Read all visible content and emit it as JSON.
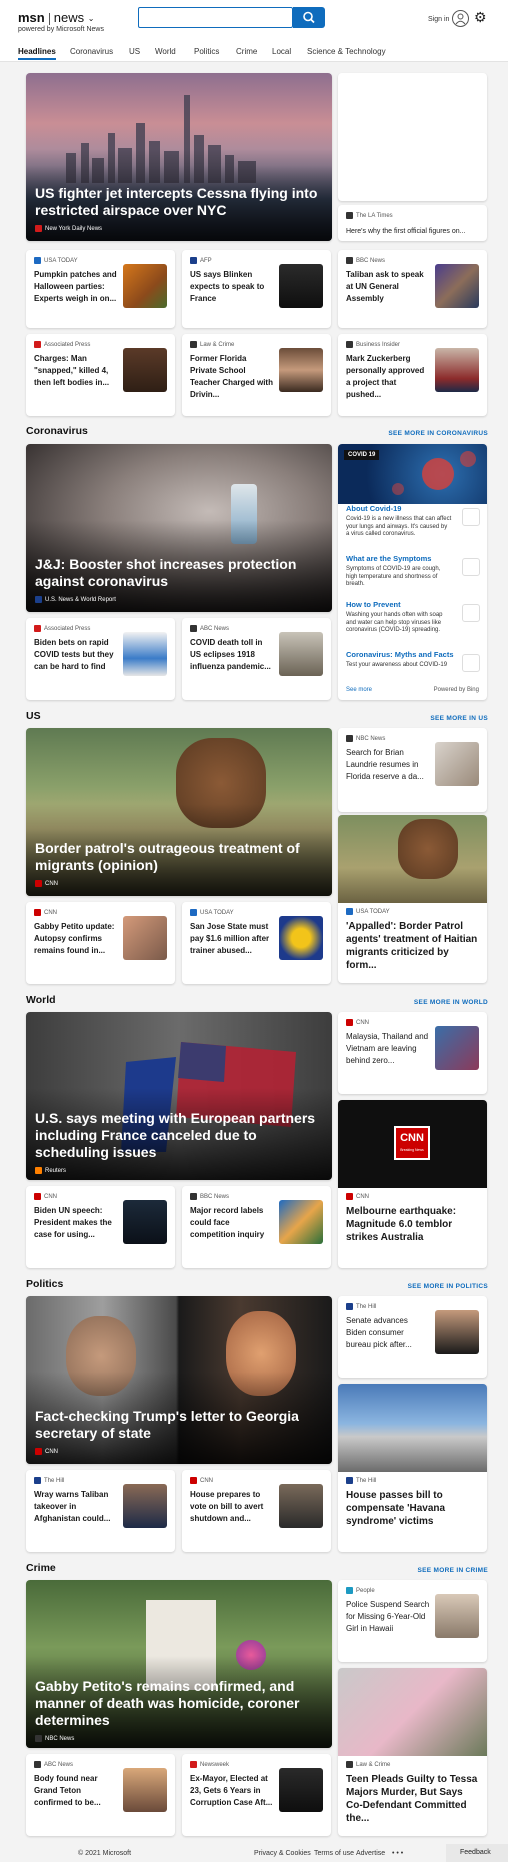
{
  "header": {
    "brand": "msn",
    "section": "news",
    "powered_by": "powered by Microsoft News",
    "search_value": "",
    "signin": "Sign in",
    "accent": "#0f6cbd"
  },
  "nav": [
    "Headlines",
    "Coronavirus",
    "US",
    "World",
    "Politics",
    "Crime",
    "Local",
    "Science & Technology"
  ],
  "top": {
    "hero": {
      "title": "US fighter jet intercepts Cessna flying into restricted airspace over NYC",
      "source": "New York Daily News"
    },
    "side": {
      "source": "The LA Times",
      "title": "Here's why the first official figures on..."
    },
    "cards": [
      {
        "source": "USA TODAY",
        "title": "Pumpkin patches and Halloween parties: Experts weigh in on..."
      },
      {
        "source": "AFP",
        "title": "US says Blinken expects to speak to France"
      },
      {
        "source": "BBC News",
        "title": "Taliban ask to speak at UN General Assembly"
      },
      {
        "source": "Associated Press",
        "title": "Charges: Man \"snapped,\" killed 4, then left bodies in..."
      },
      {
        "source": "Law & Crime",
        "title": "Former Florida Private School Teacher Charged with Drivin..."
      },
      {
        "source": "Business Insider",
        "title": "Mark Zuckerberg personally approved a project that pushed..."
      }
    ]
  },
  "coronavirus": {
    "heading": "Coronavirus",
    "more": "SEE MORE IN CORONAVIRUS",
    "hero": {
      "title": "J&J: Booster shot increases protection against coronavirus",
      "source": "U.S. News & World Report"
    },
    "cards": [
      {
        "source": "Associated Press",
        "title": "Biden bets on rapid COVID tests but they can be hard to find"
      },
      {
        "source": "ABC News",
        "title": "COVID death toll in US eclipses 1918 influenza pandemic..."
      }
    ],
    "widget": {
      "badge": "COVID 19",
      "items": [
        {
          "title": "About Covid-19",
          "desc": "Covid-19 is a new illness that can affect your lungs and airways. It's caused by a virus called coronavirus."
        },
        {
          "title": "What are the Symptoms",
          "desc": "Symptoms of COVID-19 are cough, high temperature and shortness of breath."
        },
        {
          "title": "How to Prevent",
          "desc": "Washing your hands often with soap and water can help stop viruses like coronavirus (COVID-19) spreading."
        },
        {
          "title": "Coronavirus: Myths and Facts",
          "desc": "Test your awareness about COVID-19"
        }
      ],
      "see_more": "See more",
      "powered": "Powered by Bing"
    }
  },
  "us": {
    "heading": "US",
    "more": "SEE MORE IN US",
    "hero": {
      "title": "Border patrol's outrageous treatment of migrants (opinion)",
      "source": "CNN"
    },
    "side_top": {
      "source": "NBC News",
      "title": "Search for Brian Laundrie resumes in Florida reserve a da..."
    },
    "side_big": {
      "source": "USA TODAY",
      "title": "'Appalled': Border Patrol agents' treatment of Haitian migrants criticized by form..."
    },
    "cards": [
      {
        "source": "CNN",
        "title": "Gabby Petito update: Autopsy confirms remains found in..."
      },
      {
        "source": "USA TODAY",
        "title": "San Jose State must pay $1.6 million after trainer abused..."
      }
    ]
  },
  "world": {
    "heading": "World",
    "more": "SEE MORE IN WORLD",
    "hero": {
      "title": "U.S. says meeting with European partners including France canceled due to scheduling issues",
      "source": "Reuters"
    },
    "side_top": {
      "source": "CNN",
      "title": "Malaysia, Thailand and Vietnam are leaving behind zero..."
    },
    "side_big": {
      "source": "CNN",
      "title": "Melbourne earthquake: Magnitude 6.0 temblor strikes Australia",
      "logo": "CNN",
      "logo_sub": "Breaking News"
    },
    "cards": [
      {
        "source": "CNN",
        "title": "Biden UN speech: President makes the case for using..."
      },
      {
        "source": "BBC News",
        "title": "Major record labels could face competition inquiry"
      }
    ]
  },
  "politics": {
    "heading": "Politics",
    "more": "SEE MORE IN POLITICS",
    "hero": {
      "title": "Fact-checking Trump's letter to Georgia secretary of state",
      "source": "CNN"
    },
    "side_top": {
      "source": "The Hill",
      "title": "Senate advances Biden consumer bureau pick after..."
    },
    "side_big": {
      "source": "The Hill",
      "title": "House passes bill to compensate 'Havana syndrome' victims"
    },
    "cards": [
      {
        "source": "The Hill",
        "title": "Wray warns Taliban takeover in Afghanistan could..."
      },
      {
        "source": "CNN",
        "title": "House prepares to vote on bill to avert shutdown and..."
      }
    ]
  },
  "crime": {
    "heading": "Crime",
    "more": "SEE MORE IN CRIME",
    "hero": {
      "title": "Gabby Petito's remains confirmed, and manner of death was homicide, coroner determines",
      "source": "NBC News"
    },
    "side_top": {
      "source": "People",
      "title": "Police Suspend Search for Missing 6-Year-Old Girl in Hawaii"
    },
    "side_big": {
      "source": "Law & Crime",
      "title": "Teen Pleads Guilty to Tessa Majors Murder, But Says Co-Defendant Committed the..."
    },
    "cards": [
      {
        "source": "ABC News",
        "title": "Body found near Grand Teton confirmed to be..."
      },
      {
        "source": "Newsweek",
        "title": "Ex-Mayor, Elected at 23, Gets 6 Years in Corruption Case Aft..."
      }
    ]
  },
  "footer": {
    "copyright": "© 2021 Microsoft",
    "links": [
      "Privacy & Cookies",
      "Terms of use",
      "Advertise"
    ],
    "more": "• • •",
    "feedback": "Feedback"
  }
}
